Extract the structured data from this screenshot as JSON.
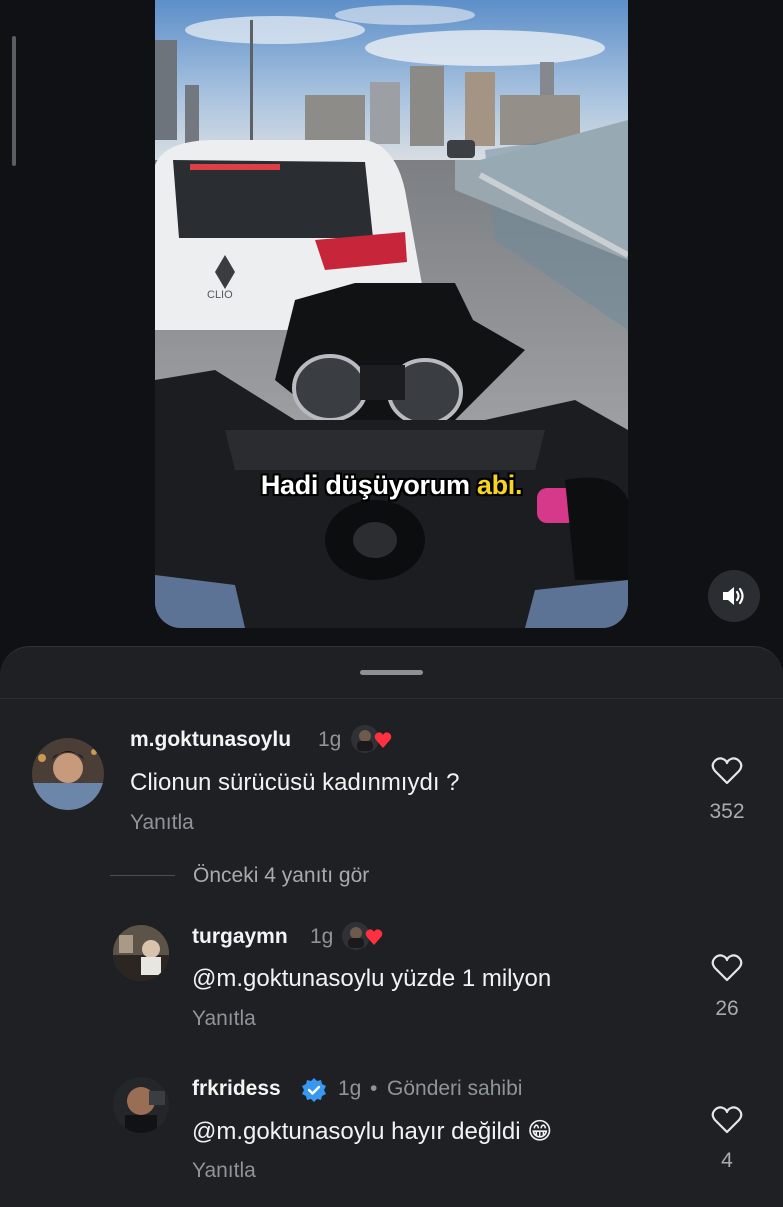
{
  "video": {
    "subtitle_part1": "Hadi düşüyorum ",
    "subtitle_highlight": "abi.",
    "car_badge_text": "CLIO"
  },
  "comments": [
    {
      "username": "m.goktunasoylu",
      "time": "1g",
      "text": "Clionun sürücüsü kadınmıydı ?",
      "reply_label": "Yanıtla",
      "likes": "352"
    }
  ],
  "view_previous_replies": "Önceki 4 yanıtı gör",
  "replies": [
    {
      "username": "turgaymn",
      "time": "1g",
      "text": "@m.goktunasoylu yüzde 1 milyon",
      "reply_label": "Yanıtla",
      "likes": "26"
    },
    {
      "username": "frkridess",
      "time": "1g",
      "separator": "•",
      "owner_label": "Gönderi sahibi",
      "text": "@m.goktunasoylu hayır değildi 😁",
      "reply_label": "Yanıtla",
      "likes": "4"
    }
  ],
  "colors": {
    "background": "#0f1114",
    "sheet": "#1e2024",
    "verified_badge": "#3897f0",
    "heart_liked": "#ff3040",
    "subtitle_highlight": "#f7d51d"
  },
  "icons": [
    "sound-on-icon",
    "heart-icon",
    "verified-badge-icon",
    "creator-liked-icon"
  ]
}
